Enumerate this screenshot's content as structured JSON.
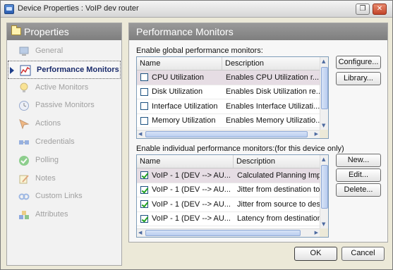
{
  "window": {
    "title": "Device Properties : VoIP dev router",
    "maximize_glyph": "❐",
    "close_glyph": "✕"
  },
  "sidebar": {
    "title": "Properties",
    "items": [
      {
        "label": "General",
        "icon": "computer-icon",
        "selected": false
      },
      {
        "label": "Performance Monitors",
        "icon": "performance-chart-icon",
        "selected": true
      },
      {
        "label": "Active Monitors",
        "icon": "lightbulb-icon",
        "selected": false
      },
      {
        "label": "Passive Monitors",
        "icon": "clock-icon",
        "selected": false
      },
      {
        "label": "Actions",
        "icon": "actions-arrow-icon",
        "selected": false
      },
      {
        "label": "Credentials",
        "icon": "credentials-icon",
        "selected": false
      },
      {
        "label": "Polling",
        "icon": "polling-check-icon",
        "selected": false
      },
      {
        "label": "Notes",
        "icon": "notes-pencil-icon",
        "selected": false
      },
      {
        "label": "Custom Links",
        "icon": "custom-links-icon",
        "selected": false
      },
      {
        "label": "Attributes",
        "icon": "attributes-cubes-icon",
        "selected": false
      }
    ]
  },
  "main": {
    "title": "Performance Monitors",
    "global": {
      "label": "Enable global performance monitors:",
      "columns": [
        "Name",
        "Description"
      ],
      "rows": [
        {
          "checked": false,
          "name": "CPU Utilization",
          "description": "Enables CPU Utilization r..."
        },
        {
          "checked": false,
          "name": "Disk Utilization",
          "description": "Enables Disk Utilization re..."
        },
        {
          "checked": false,
          "name": "Interface Utilization",
          "description": "Enables Interface Utilizati..."
        },
        {
          "checked": false,
          "name": "Memory Utilization",
          "description": "Enables Memory Utilizatio..."
        }
      ],
      "buttons": {
        "configure": "Configure...",
        "library": "Library..."
      }
    },
    "individual": {
      "label": "Enable individual performance monitors:(for this device only)",
      "columns": [
        "Name",
        "Description"
      ],
      "rows": [
        {
          "checked": true,
          "name": "VoIP - 1 (DEV --> AU...",
          "description": "Calculated Planning Impa"
        },
        {
          "checked": true,
          "name": "VoIP - 1 (DEV --> AU...",
          "description": "Jitter from destination to s"
        },
        {
          "checked": true,
          "name": "VoIP - 1 (DEV --> AU...",
          "description": "Jitter from source to dest"
        },
        {
          "checked": true,
          "name": "VoIP - 1 (DEV --> AU...",
          "description": "Latency from destination"
        }
      ],
      "buttons": {
        "new": "New...",
        "edit": "Edit...",
        "delete": "Delete..."
      }
    }
  },
  "footer": {
    "ok": "OK",
    "cancel": "Cancel"
  }
}
